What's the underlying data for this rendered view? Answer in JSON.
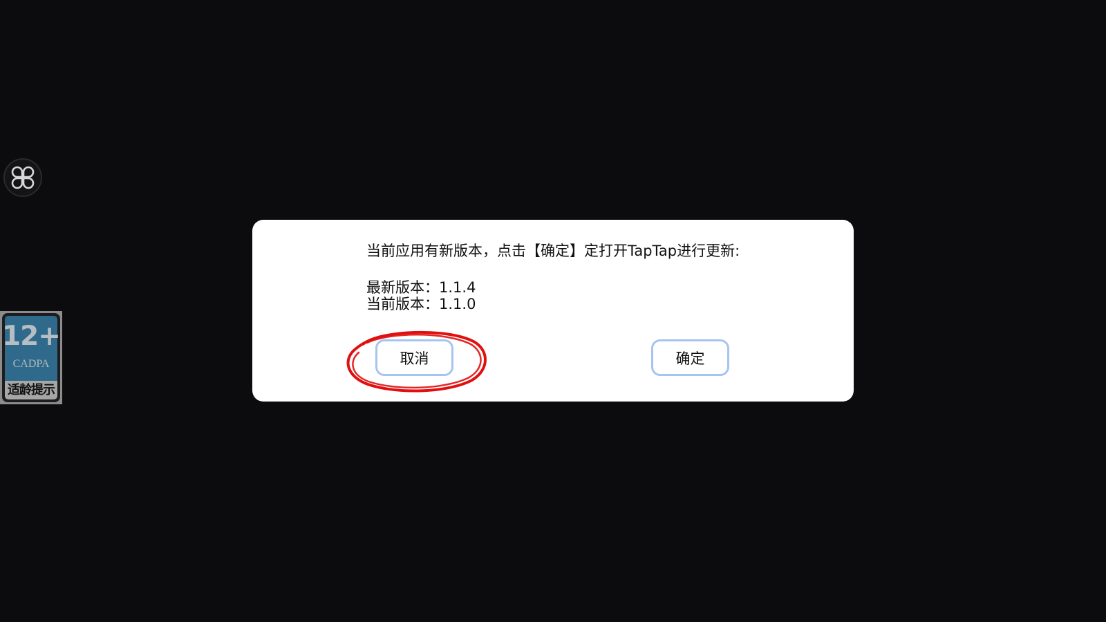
{
  "dialog": {
    "message": "当前应用有新版本，点击【确定】定打开TapTap进行更新:",
    "latest_version": "最新版本：1.1.4",
    "current_version": "当前版本：1.1.0",
    "cancel_label": "取消",
    "confirm_label": "确定"
  },
  "age_badge": {
    "rating": "12+",
    "org": "CADPA",
    "caption": "适龄提示"
  },
  "floating_button": {
    "icon": "clover-menu-icon"
  },
  "annotation": {
    "color": "#e01010",
    "target": "cancel_button"
  }
}
